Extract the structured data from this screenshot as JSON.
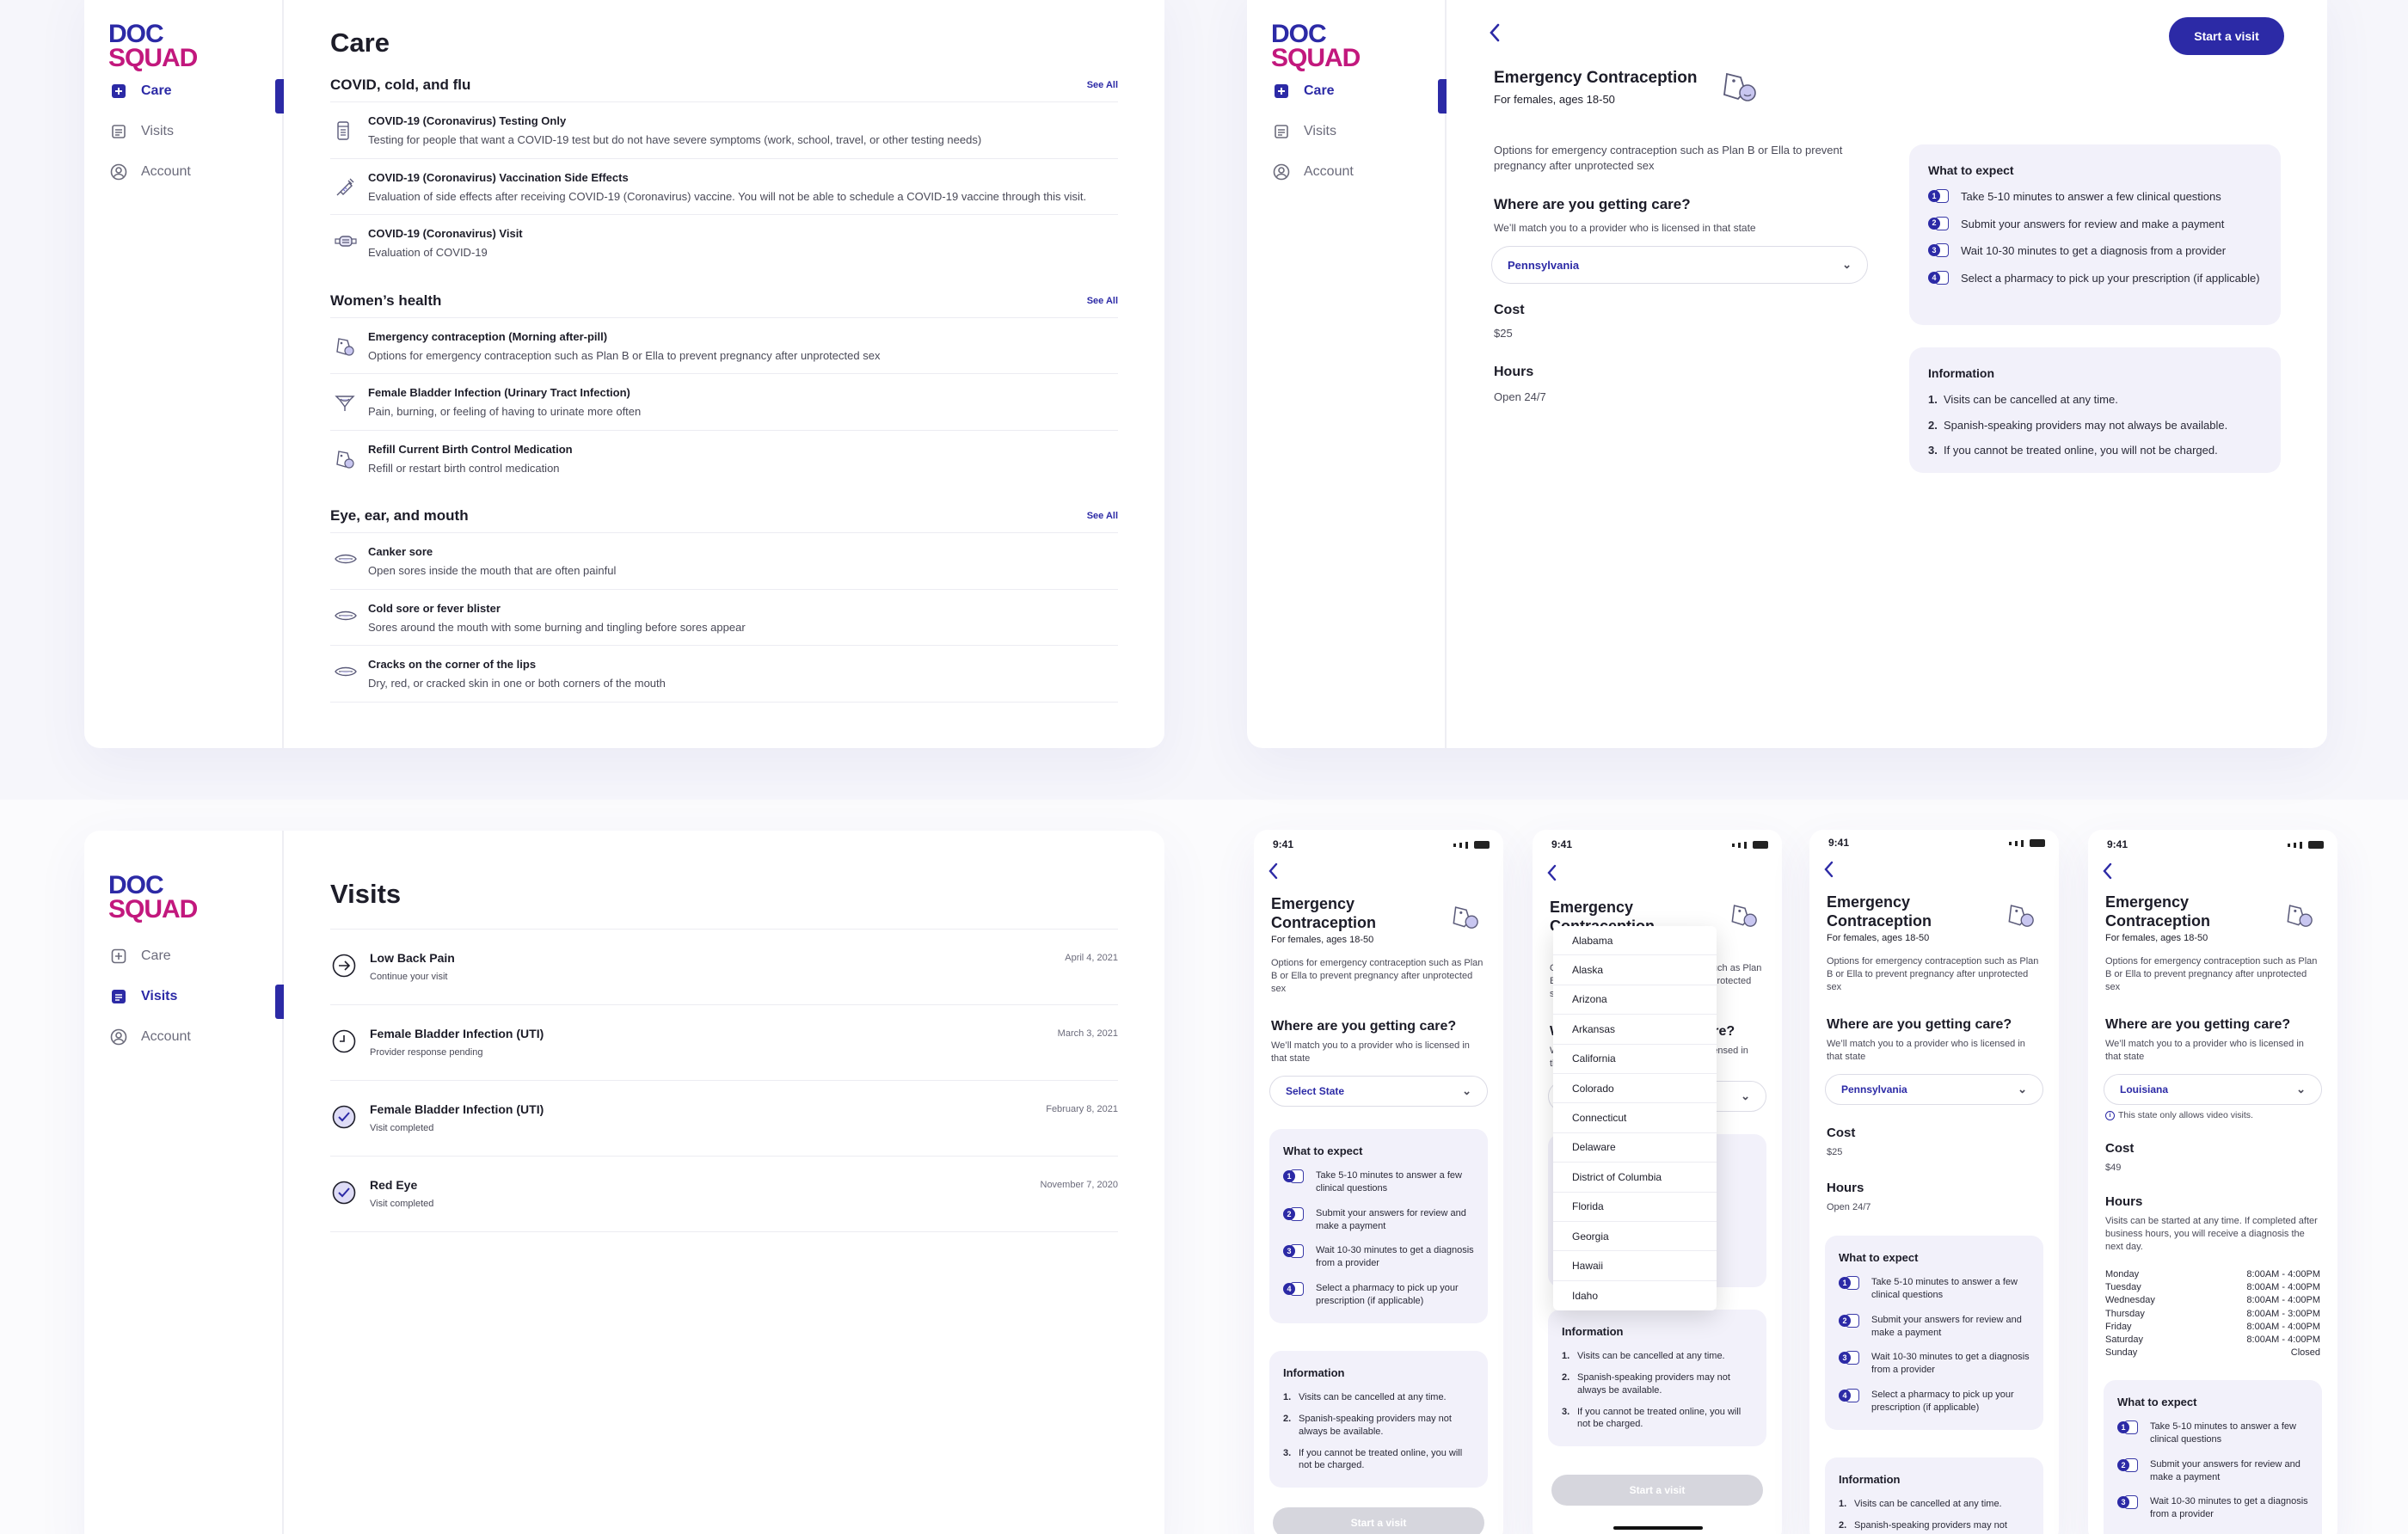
{
  "brand": {
    "logo_line1": "DOC",
    "logo_line2": "SQUAD"
  },
  "nav": {
    "care": "Care",
    "visits": "Visits",
    "account": "Account"
  },
  "care": {
    "title": "Care",
    "see_all": "See All",
    "sections": [
      {
        "title": "COVID, cold, and flu",
        "items": [
          {
            "title": "COVID-19 (Coronavirus) Testing Only",
            "desc": "Testing for people that want a COVID-19 test but do not have severe symptoms (work, school, travel, or other testing needs)",
            "icon": "test-tube-icon"
          },
          {
            "title": "COVID-19 (Coronavirus) Vaccination Side Effects",
            "desc": "Evaluation of side effects after receiving COVID-19 (Coronavirus) vaccine. You will not be able to schedule a COVID-19 vaccine through this visit.",
            "icon": "syringe-icon"
          },
          {
            "title": "COVID-19 (Coronavirus) Visit",
            "desc": "Evaluation of COVID-19",
            "icon": "mask-icon"
          }
        ]
      },
      {
        "title": "Women’s health",
        "items": [
          {
            "title": "Emergency contraception (Morning after-pill)",
            "desc": "Options for emergency contraception such as Plan B or Ella to prevent pregnancy after unprotected sex",
            "icon": "pill-icon"
          },
          {
            "title": "Female Bladder Infection (Urinary Tract Infection)",
            "desc": "Pain, burning, or feeling of having to urinate more often",
            "icon": "bladder-icon"
          },
          {
            "title": "Refill Current Birth Control Medication",
            "desc": "Refill or restart birth control medication",
            "icon": "pill-icon"
          }
        ]
      },
      {
        "title": "Eye, ear, and mouth",
        "items": [
          {
            "title": "Canker sore",
            "desc": "Open sores inside the mouth that are often painful",
            "icon": "mouth-icon"
          },
          {
            "title": "Cold sore or fever blister",
            "desc": "Sores around the mouth with some burning and tingling before sores appear",
            "icon": "mouth-icon"
          },
          {
            "title": "Cracks on the corner of the lips",
            "desc": "Dry, red, or cracked skin in one or both corners of the mouth",
            "icon": "mouth-icon"
          }
        ]
      }
    ]
  },
  "ec": {
    "start_button": "Start a visit",
    "title": "Emergency Contraception",
    "title_phone": "Emergency Contraception",
    "subtitle": "For females, ages 18-50",
    "desc": "Options for emergency contraception such as Plan B or Ella to prevent pregnancy after unprotected sex",
    "where": "Where are you getting care?",
    "match": "We’ll match you to a provider who is licensed in that state",
    "selected_state": "Pennsylvania",
    "select_placeholder": "Select State",
    "cost_label": "Cost",
    "cost_value": "$25",
    "hours_label": "Hours",
    "hours_value": "Open 24/7",
    "expect_title": "What to expect",
    "expect": [
      "Take 5-10 minutes to answer a few clinical questions",
      "Submit your answers for review and make a payment",
      "Wait 10-30 minutes to get a diagnosis from a provider",
      "Select a pharmacy to pick up your prescription (if applicable)"
    ],
    "info_title": "Information",
    "info": [
      "Visits can be cancelled at any time.",
      "Spanish-speaking providers may not always be available.",
      "If you cannot be treated online, you will not be charged."
    ]
  },
  "visits": {
    "title": "Visits",
    "items": [
      {
        "title": "Low Back Pain",
        "status": "Continue your visit",
        "date": "April 4, 2021",
        "icon": "arrow-circle-icon"
      },
      {
        "title": "Female Bladder Infection (UTI)",
        "status": "Provider response pending",
        "date": "March 3, 2021",
        "icon": "clock-icon"
      },
      {
        "title": "Female Bladder Infection (UTI)",
        "status": "Visit completed",
        "date": "February 8, 2021",
        "icon": "check-circle-icon"
      },
      {
        "title": "Red Eye",
        "status": "Visit completed",
        "date": "November 7, 2020",
        "icon": "check-circle-icon"
      }
    ]
  },
  "phones": {
    "time": "9:41",
    "states": [
      "Alabama",
      "Alaska",
      "Arizona",
      "Arkansas",
      "California",
      "Colorado",
      "Connecticut",
      "Delaware",
      "District of Columbia",
      "Florida",
      "Georgia",
      "Hawaii",
      "Idaho"
    ],
    "louisiana": {
      "state": "Louisiana",
      "note": "This state only allows video visits.",
      "cost_value": "$49",
      "hours_desc": "Visits can be started at any time. If completed after business hours, you will receive a diagnosis the next day.",
      "schedule": [
        {
          "day": "Monday",
          "time": "8:00AM - 4:00PM"
        },
        {
          "day": "Tuesday",
          "time": "8:00AM - 4:00PM"
        },
        {
          "day": "Wednesday",
          "time": "8:00AM - 4:00PM"
        },
        {
          "day": "Thursday",
          "time": "8:00AM - 3:00PM"
        },
        {
          "day": "Friday",
          "time": "8:00AM - 4:00PM"
        },
        {
          "day": "Saturday",
          "time": "8:00AM - 4:00PM"
        },
        {
          "day": "Sunday",
          "time": "Closed"
        }
      ]
    }
  }
}
